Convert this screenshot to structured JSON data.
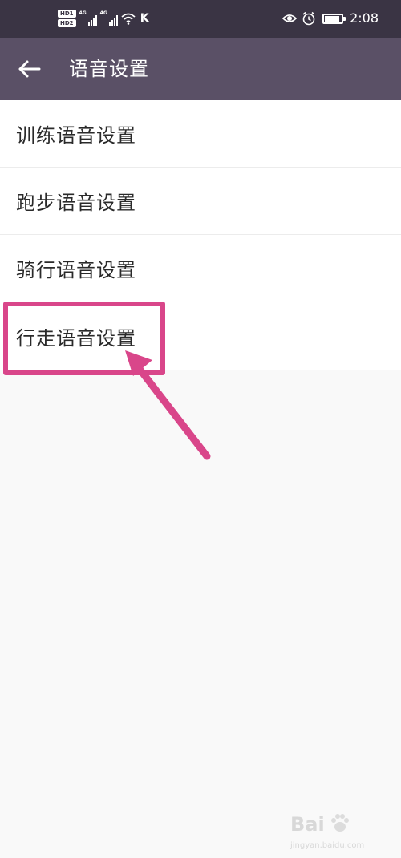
{
  "status_bar": {
    "hd_badges": [
      "HD1",
      "HD2"
    ],
    "network_labels": [
      "4G",
      "4G"
    ],
    "carrier_letter": "K",
    "time": "2:08",
    "icons": [
      "signal-icon",
      "wifi-icon",
      "eye-icon",
      "alarm-icon",
      "battery-icon"
    ]
  },
  "app_bar": {
    "title": "语音设置",
    "back_icon": "back-arrow-icon"
  },
  "settings": {
    "items": [
      {
        "label": "训练语音设置"
      },
      {
        "label": "跑步语音设置"
      },
      {
        "label": "骑行语音设置"
      },
      {
        "label": "行走语音设置"
      }
    ]
  },
  "colors": {
    "status_bar_bg": "#3a3444",
    "app_bar_bg": "#5a5066",
    "list_bg": "#ffffff",
    "page_bg": "#f9f9f9",
    "highlight": "#d9468a"
  },
  "watermark": {
    "logo": "Bai",
    "sub": "jingyan.baidu.com"
  }
}
